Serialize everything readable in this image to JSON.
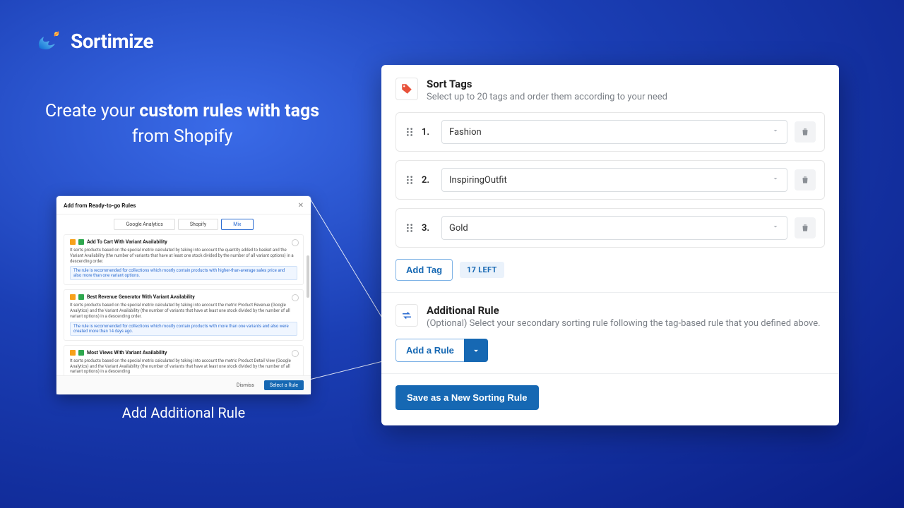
{
  "brand": {
    "name": "Sortimize"
  },
  "headline": {
    "pre": "Create your ",
    "bold1": "custom rules with tags",
    "post": " from Shopify"
  },
  "preview": {
    "title": "Add from Ready-to-go Rules",
    "tabs": [
      "Google Analytics",
      "Shopify",
      "Mix"
    ],
    "activeTabIndex": 2,
    "rules": [
      {
        "title": "Add To Cart With Variant Availability",
        "desc": "It sorts products based on the special metric calculated by taking into account the quantity added to basket and the Variant Availability (the number of variants that have at least one stock divided by the number of all variant options) in a descending order.",
        "note": "The rule is recommended for collections which mostly contain products with higher-than-average sales price and also more than one variant options."
      },
      {
        "title": "Best Revenue Generator With Variant Availability",
        "desc": "It sorts products based on the special metric calculated by taking into account the metric Product Revenue (Google Analytics) and the Variant Availability (the number of variants that have at least one stock divided by the number of all variant options) in a descending order.",
        "note": "The rule is recommended for collections which mostly contain products with more than one variants and also were created more than 14 days ago."
      },
      {
        "title": "Most Views With Variant Availability",
        "desc": "It sorts products based on the special metric calculated by taking into account the metric Product Detail View (Google Analytics) and the Variant Availability (the number of variants that have at least one stock divided by the number of all variant options) in a descending",
        "note": ""
      }
    ],
    "dismiss": "Dismiss",
    "select": "Select a Rule",
    "caption": "Add Additional Rule"
  },
  "panel": {
    "sortTags": {
      "title": "Sort Tags",
      "subtitle": "Select up to 20 tags and order them according to your need",
      "items": [
        {
          "index": "1.",
          "value": "Fashion"
        },
        {
          "index": "2.",
          "value": "InspiringOutfit"
        },
        {
          "index": "3.",
          "value": "Gold"
        }
      ],
      "addTag": "Add Tag",
      "leftBadge": "17 LEFT"
    },
    "additional": {
      "title": "Additional Rule",
      "subtitle": "(Optional) Select your secondary sorting rule following the tag-based rule that you defined above.",
      "addRule": "Add a Rule"
    },
    "save": "Save as a New Sorting Rule"
  }
}
